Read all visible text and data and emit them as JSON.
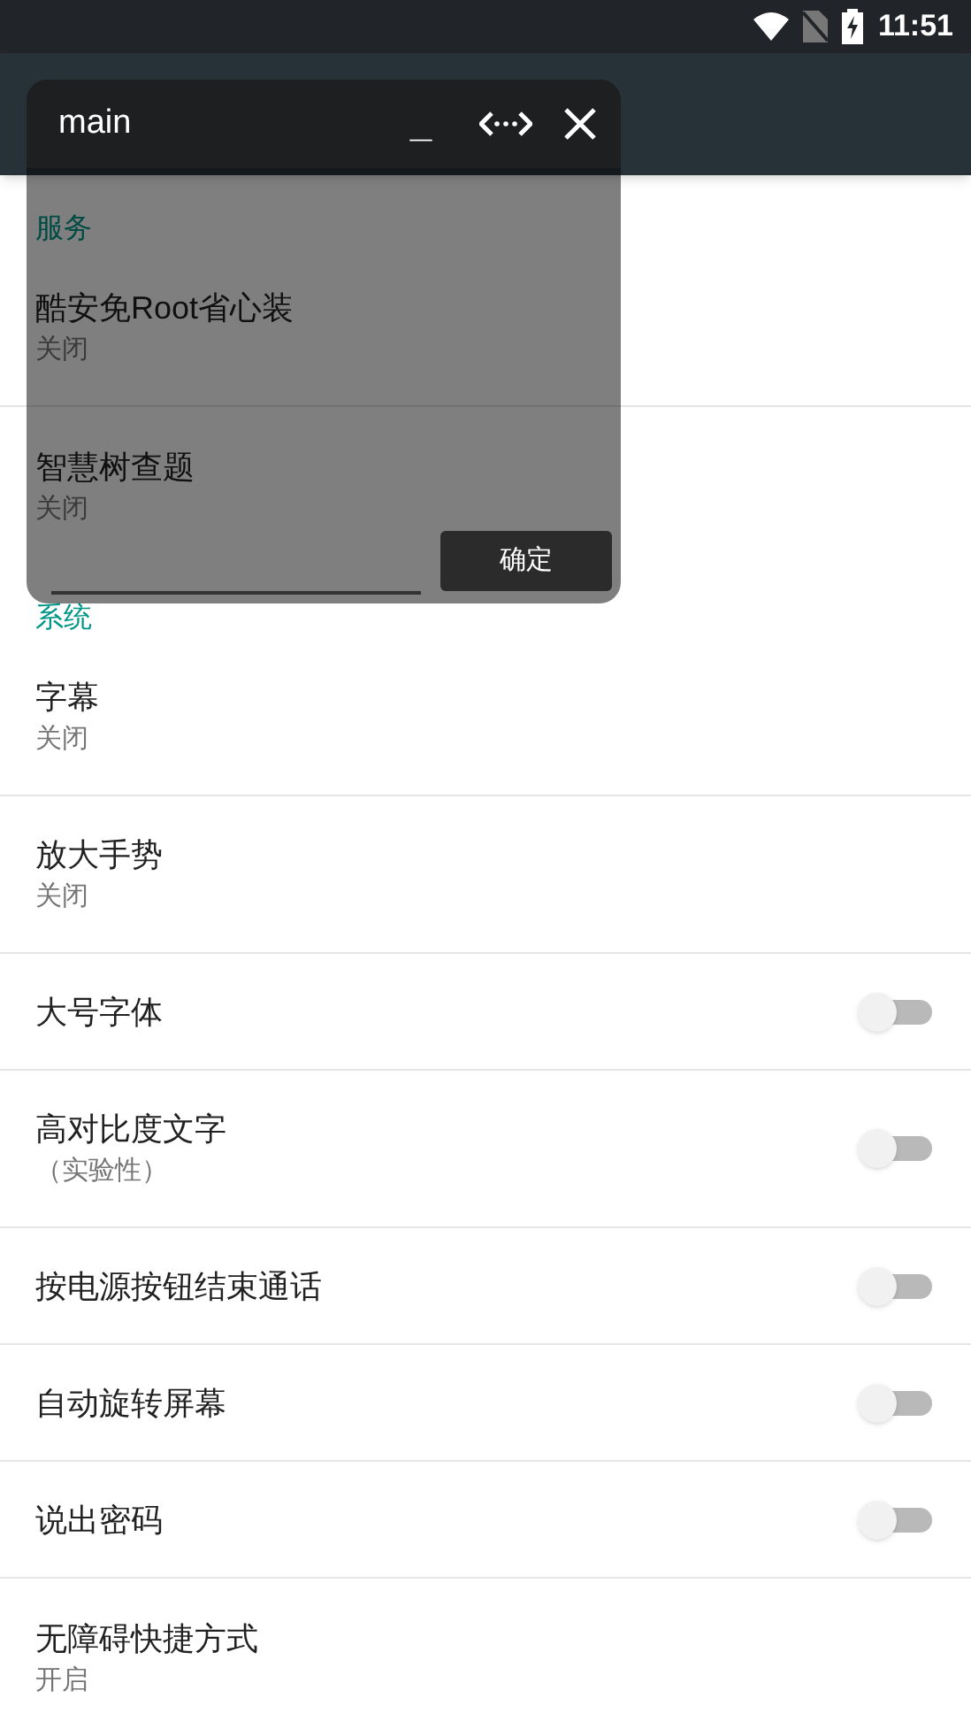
{
  "status_bar": {
    "time": "11:51"
  },
  "sections": [
    {
      "header": "服务",
      "items": [
        {
          "kind": "text",
          "title": "酷安免Root省心装",
          "summary": "关闭"
        },
        {
          "kind": "text",
          "title": "智慧树查题",
          "summary": "关闭"
        }
      ]
    },
    {
      "header": "系统",
      "items": [
        {
          "kind": "text",
          "title": "字幕",
          "summary": "关闭"
        },
        {
          "kind": "text",
          "title": "放大手势",
          "summary": "关闭"
        },
        {
          "kind": "switch",
          "title": "大号字体",
          "on": false
        },
        {
          "kind": "switch",
          "title": "高对比度文字",
          "summary": "（实验性）",
          "on": false
        },
        {
          "kind": "switch",
          "title": "按电源按钮结束通话",
          "on": false
        },
        {
          "kind": "switch",
          "title": "自动旋转屏幕",
          "on": false
        },
        {
          "kind": "switch",
          "title": "说出密码",
          "on": false
        },
        {
          "kind": "text",
          "title": "无障碍快捷方式",
          "summary": "开启"
        }
      ]
    }
  ],
  "floating_window": {
    "title": "main",
    "minimize": "_",
    "confirm_button": "确定"
  }
}
